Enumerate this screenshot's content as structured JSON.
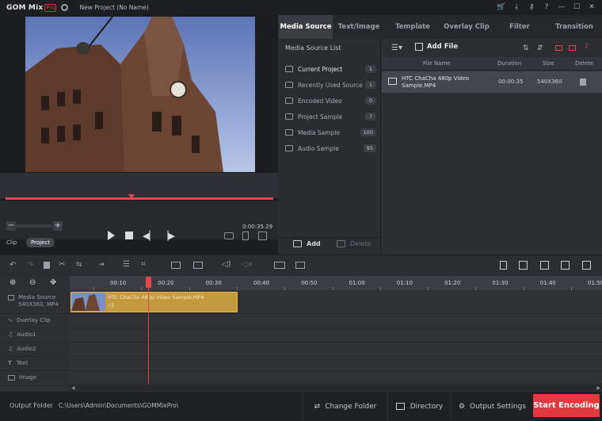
{
  "titlebar": {
    "app_name": "GOM Mix",
    "app_badge": "Pro",
    "project_title": "New Project (No Name)"
  },
  "preview": {
    "timecode": "0:00:35.29",
    "mode_tabs": [
      {
        "label": "Clip"
      },
      {
        "label": "Project"
      }
    ]
  },
  "media_tabs": [
    {
      "label": "Media Source"
    },
    {
      "label": "Text/Image"
    },
    {
      "label": "Template"
    },
    {
      "label": "Overlay Clip"
    },
    {
      "label": "Filter"
    },
    {
      "label": "Transition"
    }
  ],
  "media_sidebar": {
    "title": "Media Source List",
    "items": [
      {
        "label": "Current Project",
        "count": "1"
      },
      {
        "label": "Recently Used Source",
        "count": "1"
      },
      {
        "label": "Encoded Video",
        "count": "0"
      },
      {
        "label": "Project Sample",
        "count": "7"
      },
      {
        "label": "Media Sample",
        "count": "100"
      },
      {
        "label": "Audio Sample",
        "count": "95"
      }
    ],
    "add_label": "Add",
    "delete_label": "Delete"
  },
  "media_list": {
    "add_file_label": "Add File",
    "columns": [
      "File Name",
      "Duration",
      "Size",
      "Delete"
    ],
    "rows": [
      {
        "file_name": "HTC ChaCha 480p Video Sample.MP4",
        "duration": "00:00:35",
        "size": "540X360"
      }
    ]
  },
  "timeline": {
    "ruler": [
      "00:10",
      "00:20",
      "00:30",
      "00:40",
      "00:50",
      "01:00",
      "01:10",
      "01:20",
      "01:30",
      "01:40",
      "01:50"
    ],
    "tracks": [
      {
        "label": "Media Source",
        "sub": "540X360, MP4"
      },
      {
        "label": "Overlay Clip"
      },
      {
        "label": "Audio1"
      },
      {
        "label": "Audio2"
      },
      {
        "label": "Text"
      },
      {
        "label": "Image"
      }
    ],
    "clip_label": "HTC ChaCha 480p Video Sample.MP4"
  },
  "footer": {
    "output_folder_label": "Output Folder",
    "output_folder_path": "C:\\Users\\Admin\\Documents\\GOMMixPro\\",
    "change_folder": "Change Folder",
    "directory": "Directory",
    "output_settings": "Output Settings",
    "start_encoding": "Start Encoding"
  }
}
